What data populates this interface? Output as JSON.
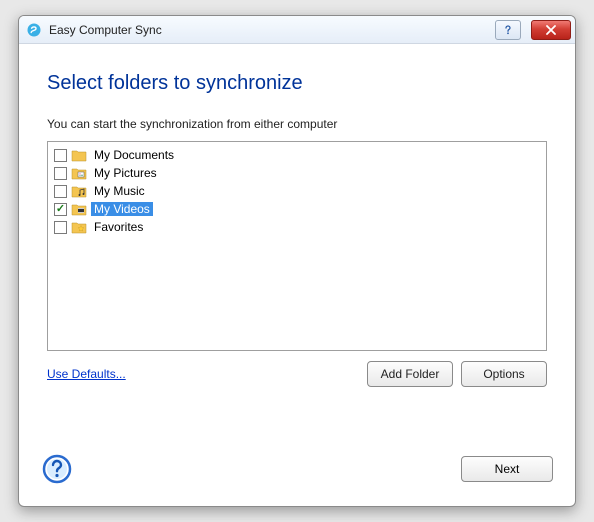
{
  "titlebar": {
    "app_name": "Easy Computer Sync"
  },
  "heading": "Select folders to synchronize",
  "subtext": "You can start the synchronization from either computer",
  "folders": [
    {
      "label": "My Documents",
      "checked": false,
      "selected": false,
      "icon": "folder"
    },
    {
      "label": "My Pictures",
      "checked": false,
      "selected": false,
      "icon": "folder-pic"
    },
    {
      "label": "My Music",
      "checked": false,
      "selected": false,
      "icon": "folder-music"
    },
    {
      "label": "My Videos",
      "checked": true,
      "selected": true,
      "icon": "folder-video"
    },
    {
      "label": "Favorites",
      "checked": false,
      "selected": false,
      "icon": "folder-star"
    }
  ],
  "links": {
    "use_defaults": "Use Defaults..."
  },
  "buttons": {
    "add_folder": "Add Folder",
    "options": "Options",
    "next": "Next"
  }
}
